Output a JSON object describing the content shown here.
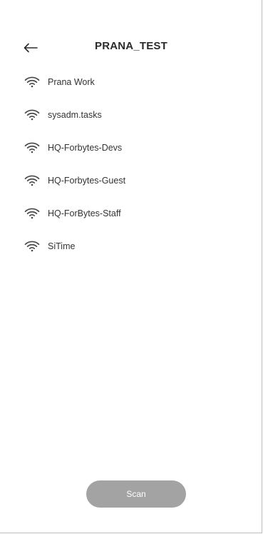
{
  "header": {
    "title": "PRANA_TEST",
    "back_icon": "arrow-left-icon"
  },
  "networks": [
    {
      "label": "Prana Work",
      "icon": "wifi-icon"
    },
    {
      "label": "sysadm.tasks",
      "icon": "wifi-icon"
    },
    {
      "label": "HQ-Forbytes-Devs",
      "icon": "wifi-icon"
    },
    {
      "label": "HQ-Forbytes-Guest",
      "icon": "wifi-icon"
    },
    {
      "label": "HQ-ForBytes-Staff",
      "icon": "wifi-icon"
    },
    {
      "label": "SiTime",
      "icon": "wifi-icon"
    }
  ],
  "actions": {
    "scan_label": "Scan"
  },
  "colors": {
    "scan_button": "#a3a3a3",
    "text": "#333333",
    "border": "#bdbdbd"
  }
}
